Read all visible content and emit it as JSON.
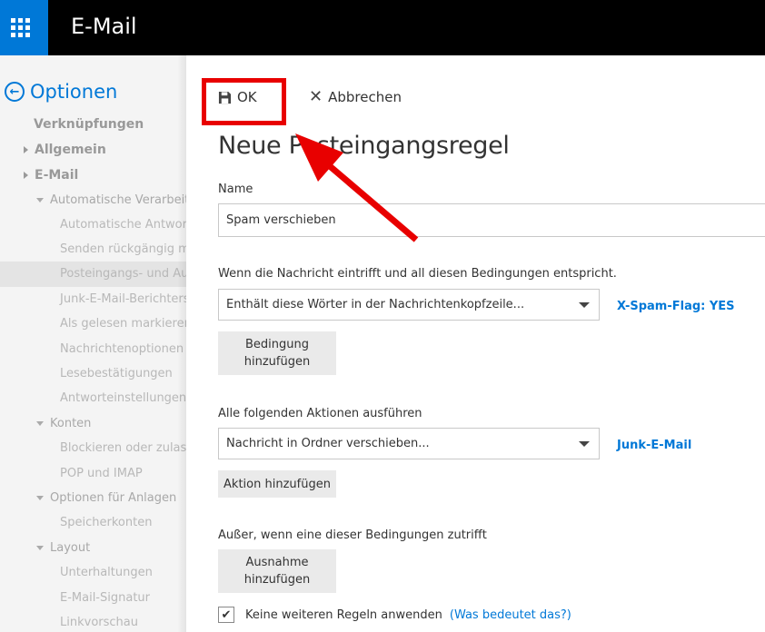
{
  "header": {
    "title": "E-Mail"
  },
  "sidebar": {
    "back_label": "Optionen",
    "items": [
      {
        "label": "Verknüpfungen"
      },
      {
        "label": "Allgemein"
      },
      {
        "label": "E-Mail"
      },
      {
        "label": "Automatische Verarbeitung"
      },
      {
        "label": "Automatische Antworten"
      },
      {
        "label": "Senden rückgängig machen"
      },
      {
        "label": "Posteingangs- und Aufräumregeln"
      },
      {
        "label": "Junk-E-Mail-Berichterstattung"
      },
      {
        "label": "Als gelesen markieren"
      },
      {
        "label": "Nachrichtenoptionen"
      },
      {
        "label": "Lesebestätigungen"
      },
      {
        "label": "Antworteinstellungen"
      },
      {
        "label": "Konten"
      },
      {
        "label": "Blockieren oder zulassen"
      },
      {
        "label": "POP und IMAP"
      },
      {
        "label": "Optionen für Anlagen"
      },
      {
        "label": "Speicherkonten"
      },
      {
        "label": "Layout"
      },
      {
        "label": "Unterhaltungen"
      },
      {
        "label": "E-Mail-Signatur"
      },
      {
        "label": "Linkvorschau"
      }
    ]
  },
  "toolbar": {
    "ok_label": "OK",
    "cancel_label": "Abbrechen"
  },
  "form": {
    "title": "Neue Posteingangsregel",
    "name_label": "Name",
    "name_value": "Spam verschieben",
    "condition_label": "Wenn die Nachricht eintrifft und all diesen Bedingungen entspricht.",
    "condition_select": "Enthält diese Wörter in der Nachrichtenkopfzeile...",
    "condition_value": "X-Spam-Flag: YES",
    "add_condition_button": "Bedingung hinzufügen",
    "action_label": "Alle folgenden Aktionen ausführen",
    "action_select": "Nachricht in Ordner verschieben...",
    "action_value": "Junk-E-Mail",
    "add_action_button": "Aktion hinzufügen",
    "exception_label": "Außer, wenn eine dieser Bedingungen zutrifft",
    "add_exception_button": "Ausnahme hinzufügen",
    "stop_rules_label": "Keine weiteren Regeln anwenden",
    "stop_rules_checked": true,
    "help_link": "(Was bedeutet das?)"
  },
  "colors": {
    "accent": "#0078d7",
    "highlight": "#e80000",
    "topbar": "#000000"
  }
}
